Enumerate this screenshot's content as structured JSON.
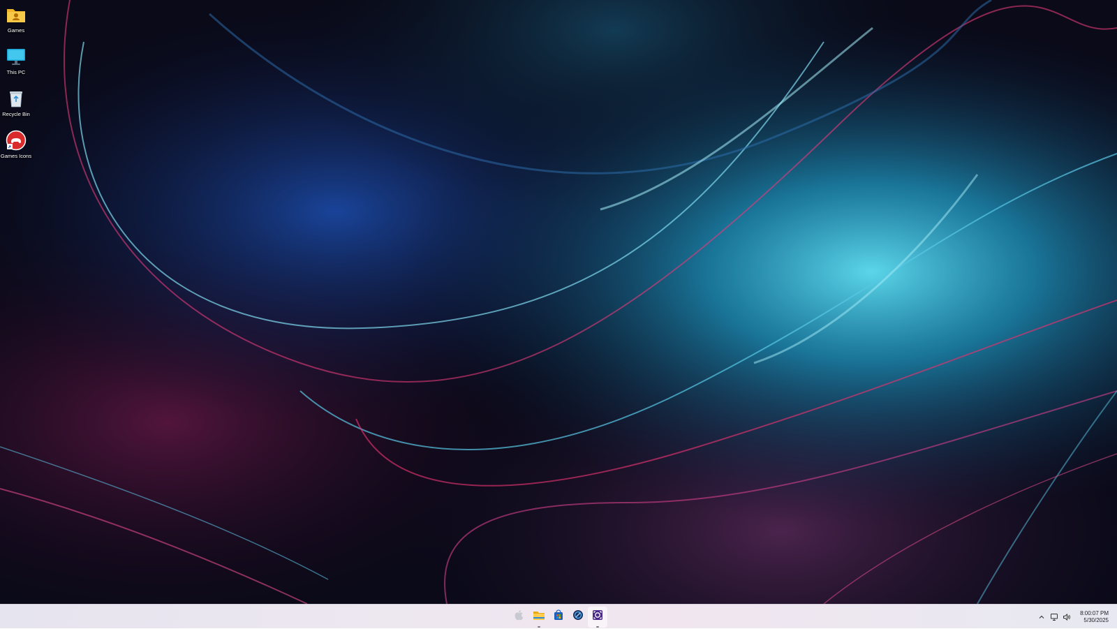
{
  "desktop": {
    "icons": [
      {
        "label": "Games",
        "icon": "folder-user-icon"
      },
      {
        "label": "This PC",
        "icon": "monitor-icon"
      },
      {
        "label": "Recycle Bin",
        "icon": "recycle-bin-icon"
      },
      {
        "label": "Games Icons",
        "icon": "gamepad-shortcut-icon"
      }
    ]
  },
  "taskbar": {
    "pinned": [
      {
        "name": "apple-logo-icon",
        "running": false
      },
      {
        "name": "file-explorer-icon",
        "running": true
      },
      {
        "name": "microsoft-store-icon",
        "running": false
      },
      {
        "name": "app-circle-icon",
        "running": false
      },
      {
        "name": "screen-capture-icon",
        "running": true
      }
    ],
    "tray": {
      "icons": [
        "chevron-up-icon",
        "network-icon",
        "volume-icon"
      ],
      "time": "8:00:07 PM",
      "date": "5/30/2025"
    }
  },
  "colors": {
    "accent_blue": "#35c2ea",
    "accent_pink": "#e0336f",
    "taskbar_bg": "#ece7f0"
  }
}
